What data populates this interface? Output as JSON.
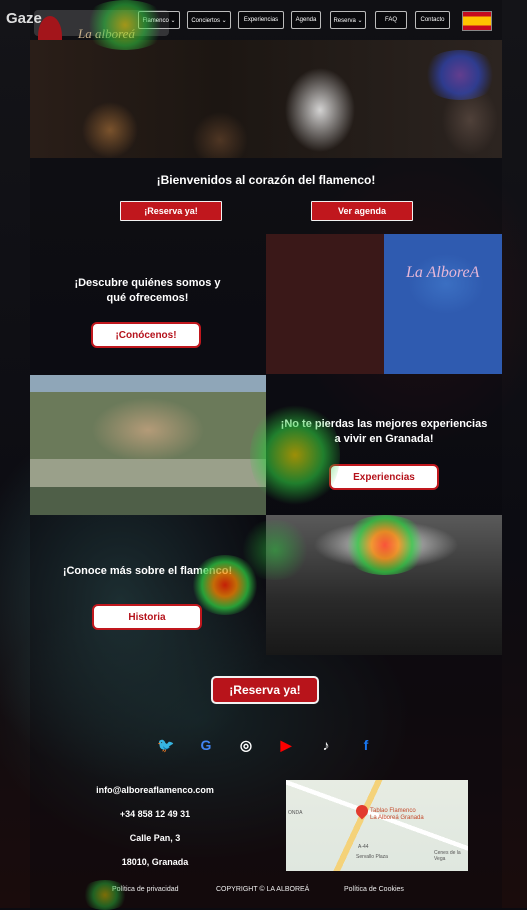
{
  "watermark": "Gaze",
  "logo_text": "La alboreá",
  "nav": {
    "items": [
      "Flamenco ⌄",
      "Conciertos ⌄",
      "Experiencias",
      "Agenda",
      "Reserva ⌄",
      "FAQ",
      "Contacto"
    ]
  },
  "hero": {
    "welcome": "¡Bienvenidos al corazón del flamenco!",
    "reserve_label": "¡Reserva ya!",
    "agenda_label": "Ver agenda"
  },
  "about": {
    "text_line1": "¡Descubre quiénes somos y",
    "text_line2": "qué ofrecemos!",
    "button": "¡Conócenos!",
    "stage_logo": "La AlboreA"
  },
  "experiences": {
    "text_line1": "¡No te pierdas las mejores experiencias",
    "text_line2": "a vivir en Granada!",
    "button": "Experiencias"
  },
  "history": {
    "text": "¡Conoce más sobre el flamenco!",
    "button": "Historia"
  },
  "cta": {
    "reserve_label": "¡Reserva ya!"
  },
  "social": [
    {
      "name": "twitter-icon",
      "glyph": "🐦",
      "color": "#1d9bf0"
    },
    {
      "name": "google-icon",
      "glyph": "G",
      "color": "#4285f4"
    },
    {
      "name": "instagram-icon",
      "glyph": "◎",
      "color": "#ffffff"
    },
    {
      "name": "youtube-icon",
      "glyph": "▶",
      "color": "#ff0000"
    },
    {
      "name": "tiktok-icon",
      "glyph": "♪",
      "color": "#ffffff"
    },
    {
      "name": "facebook-icon",
      "glyph": "f",
      "color": "#1877f2"
    }
  ],
  "contact": {
    "email": "info@alboreaflamenco.com",
    "phone": "+34 858 12 49 31",
    "address": "Calle Pan, 3",
    "city": "18010, Granada"
  },
  "map": {
    "place_line1": "Tablao Flamenco",
    "place_line2": "La Alboreá Granada",
    "label_onda": "ONDA",
    "label_plaza": "Servallo Plaza",
    "label_cenes": "Cenes de la Vega",
    "label_road": "A-44"
  },
  "footer": {
    "privacy": "Política de privacidad",
    "copyright": "COPYRIGHT © LA ALBOREÁ",
    "cookies": "Política de Cookies"
  },
  "colors": {
    "brand_red": "#c0171d",
    "accent_gold": "#c9b28c"
  }
}
